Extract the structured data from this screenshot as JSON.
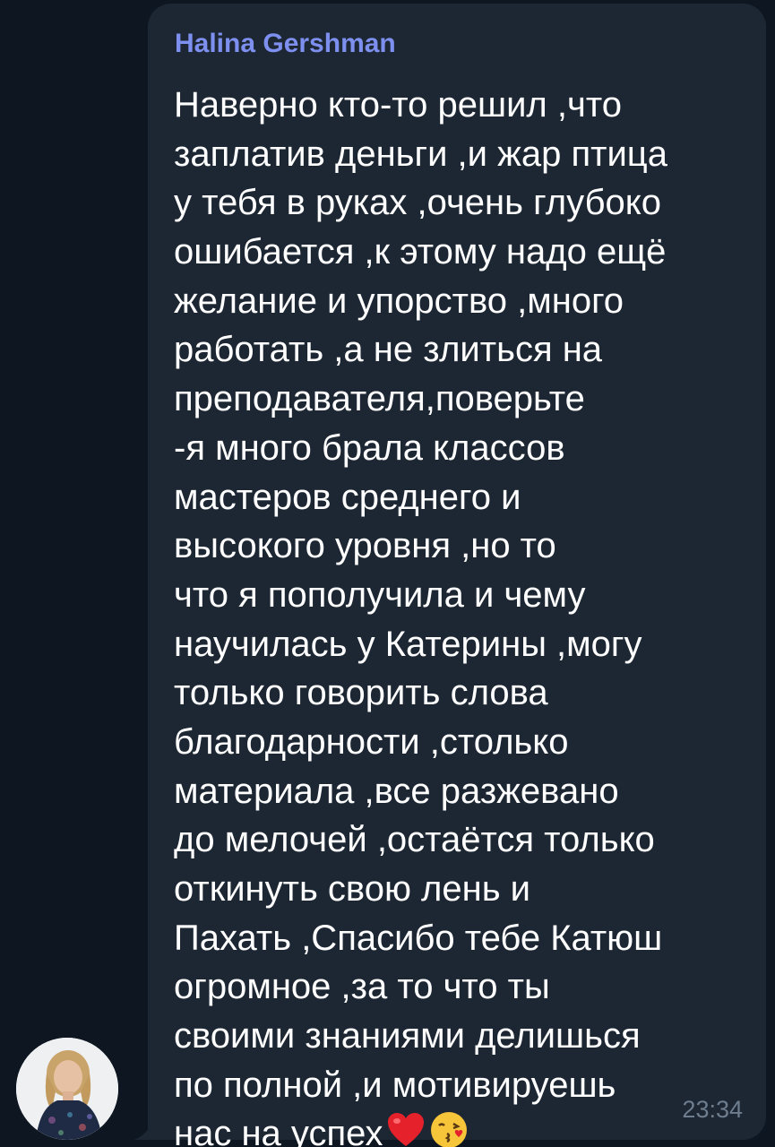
{
  "chat": {
    "sender_name": "Halina Gershman",
    "message_lines": [
      "Наверно кто-то решил ,что",
      "заплатив деньги ,и жар птица",
      "у тебя в руках ,очень глубоко",
      "ошибается ,к этому надо ещё",
      "желание и упорство ,много",
      "работать ,а не злиться на",
      "преподавателя,поверьте",
      "-я много брала классов",
      "мастеров среднего и",
      "высокого уровня ,но то",
      "что я пополучила и чему",
      "научилась у Катерины ,могу",
      "только говорить слова",
      "благодарности ,столько",
      "материала ,все разжевано",
      "до мелочей ,остаётся только",
      "откинуть свою лень и",
      "Пахать ,Спасибо тебе Катюш",
      "огромное ,за то что ты",
      "своими знаниями делишься",
      "по полной ,и мотивируешь",
      "нас на успех"
    ],
    "emojis": [
      "heart-emoji",
      "kissing-face-emoji"
    ],
    "time": "23:34",
    "colors": {
      "background": "#0e1621",
      "bubble": "#1d2733",
      "sender": "#7d8fef",
      "text": "#ffffff",
      "time": "#6d7d8e"
    }
  }
}
